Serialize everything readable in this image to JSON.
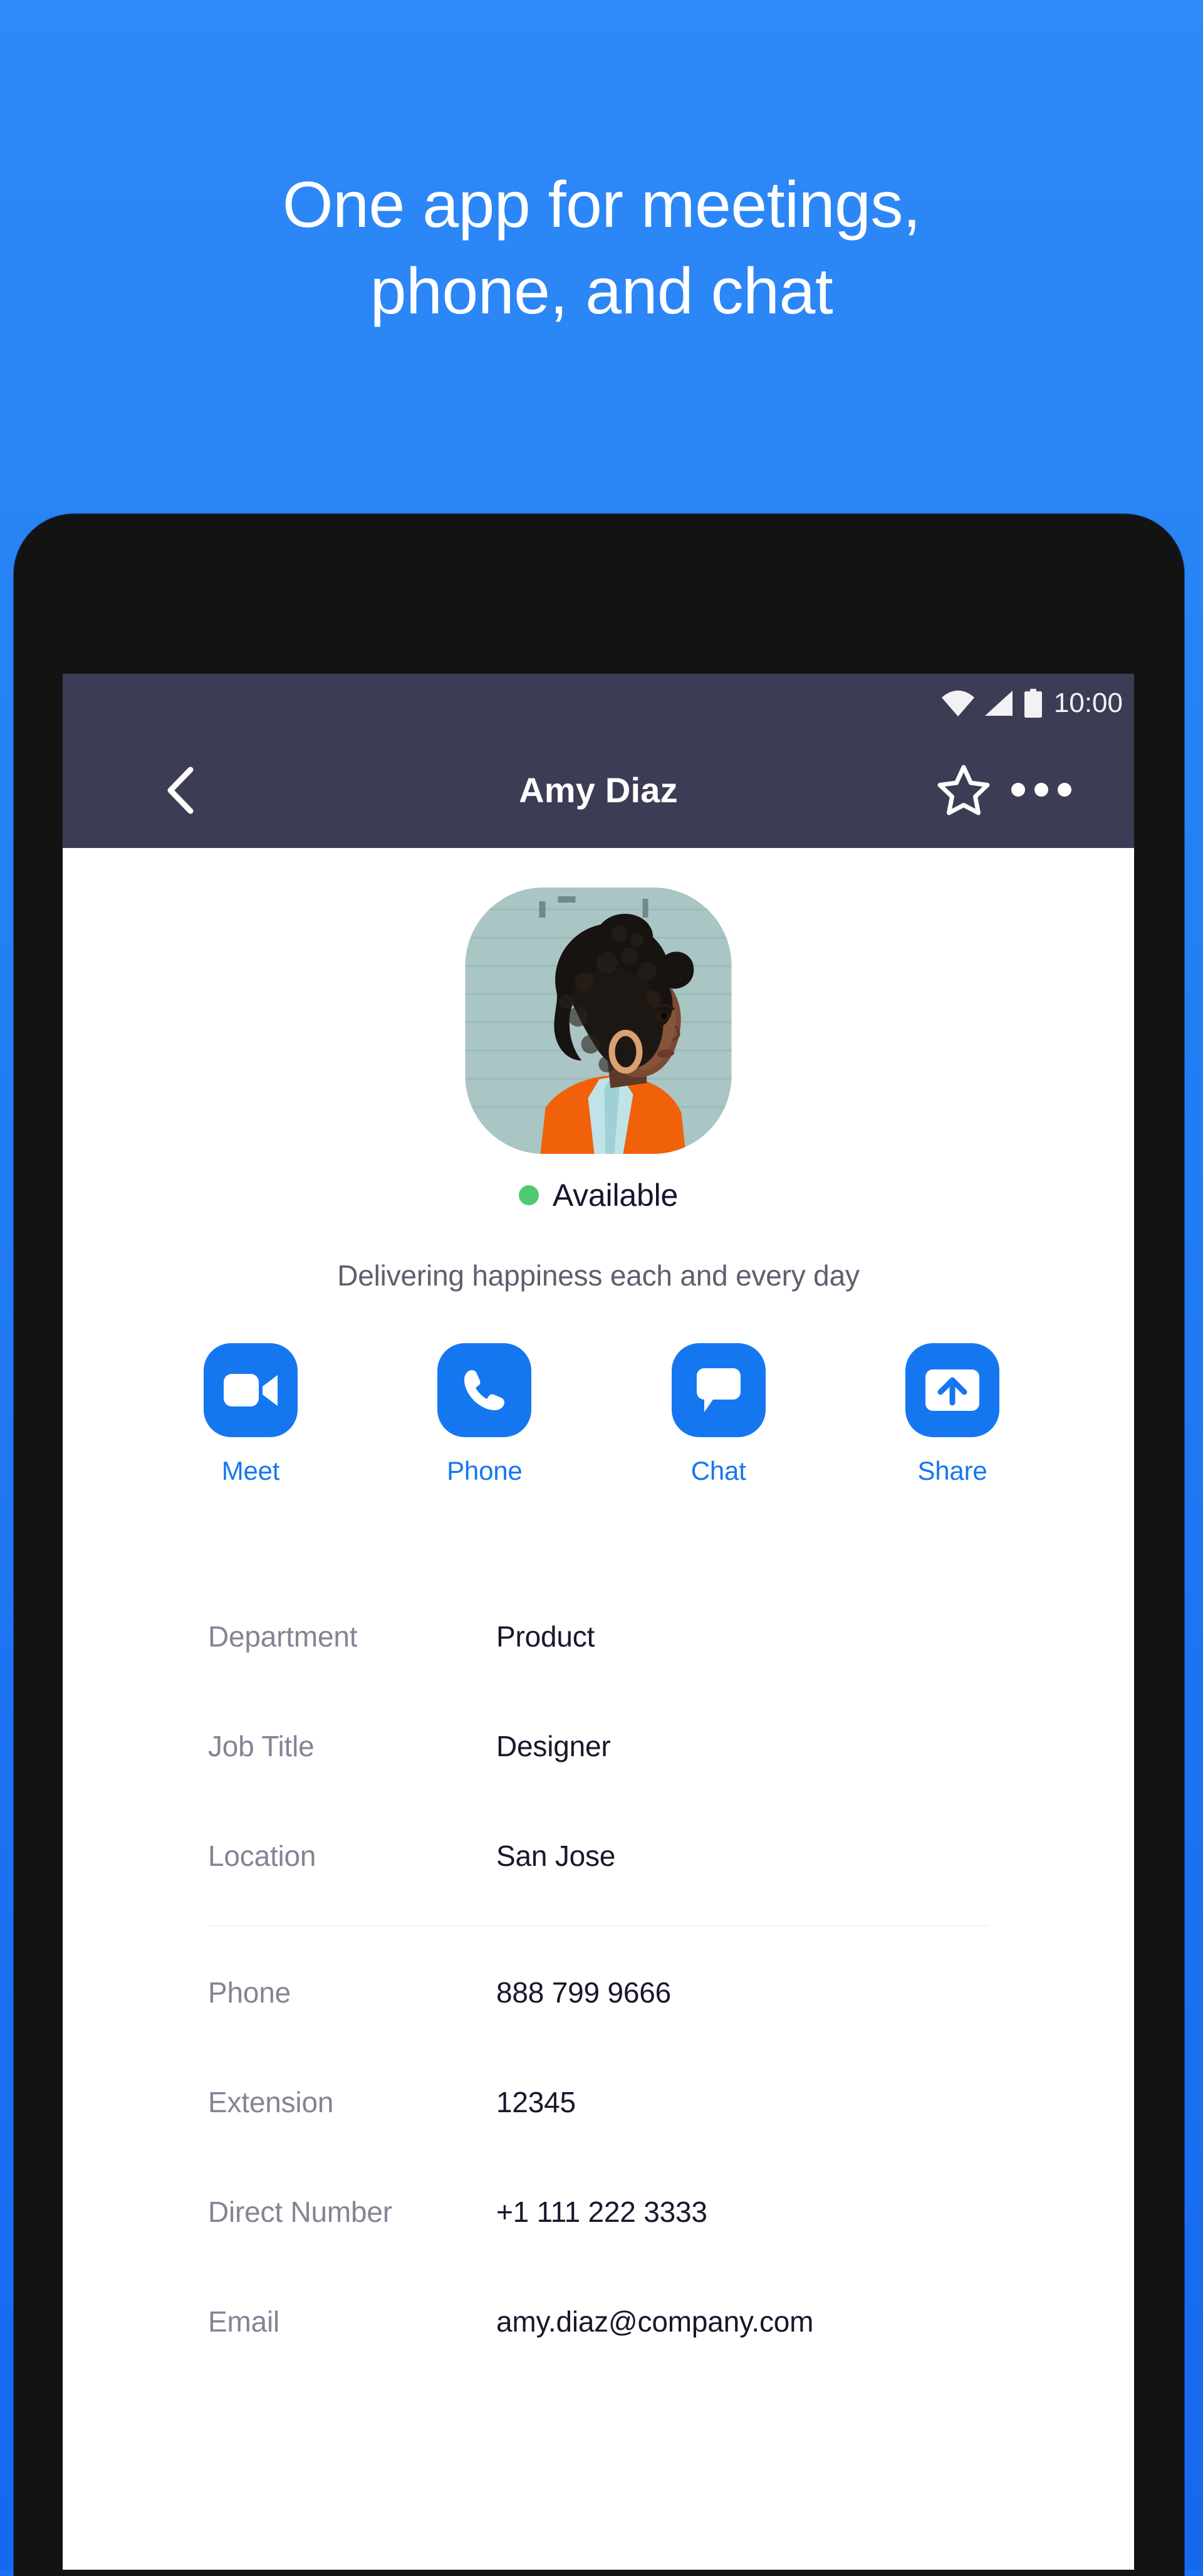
{
  "promo": {
    "headline": "One app for meetings,\nphone, and chat",
    "background_color": "#2480f4",
    "accent_color": "#1577f0"
  },
  "device": {
    "bezel_color": "#131313",
    "camera_icon": "front-camera-dot",
    "sensor_icon": "proximity-sensor-dot",
    "speaker_icon": "earpiece-speaker"
  },
  "status_bar": {
    "background_color": "#3c3d55",
    "wifi_icon": "wifi-icon",
    "signal_icon": "cellular-signal-icon",
    "battery_icon": "battery-icon",
    "time": "10:00"
  },
  "nav_bar": {
    "background_color": "#3c3d55",
    "back_icon": "chevron-left-icon",
    "title": "Amy Diaz",
    "star_icon": "star-outline-icon",
    "more_icon": "more-horizontal-icon"
  },
  "profile": {
    "avatar_background": "#a9c5c4",
    "presence": {
      "status": "Available",
      "dot_color": "#4ecb71"
    },
    "tagline": "Delivering happiness each and every day"
  },
  "actions": [
    {
      "label": "Meet",
      "icon": "video-camera-icon"
    },
    {
      "label": "Phone",
      "icon": "phone-handset-icon"
    },
    {
      "label": "Chat",
      "icon": "chat-bubble-icon"
    },
    {
      "label": "Share",
      "icon": "share-upload-icon"
    }
  ],
  "details": {
    "group_one": [
      {
        "key": "Department",
        "value": "Product"
      },
      {
        "key": "Job Title",
        "value": "Designer"
      },
      {
        "key": "Location",
        "value": "San Jose"
      }
    ],
    "group_two": [
      {
        "key": "Phone",
        "value": "888 799 9666"
      },
      {
        "key": "Extension",
        "value": "12345"
      },
      {
        "key": "Direct Number",
        "value": "+1 111 222 3333"
      },
      {
        "key": "Email",
        "value": "amy.diaz@company.com"
      }
    ]
  }
}
